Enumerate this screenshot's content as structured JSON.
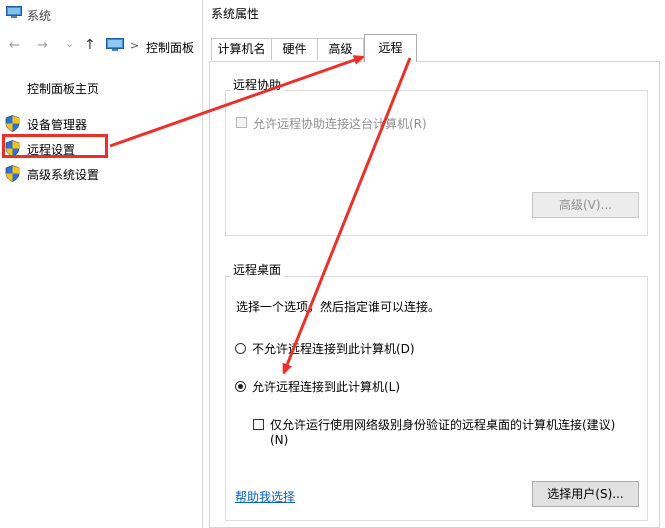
{
  "control_panel": {
    "window_title": "系统",
    "nav": {
      "back": "←",
      "forward": "→",
      "dropdown": "⌄",
      "up": "↑"
    },
    "breadcrumb_sep": ">",
    "address": "控制面板",
    "home_link": "控制面板主页",
    "links": [
      {
        "label": "设备管理器",
        "icon": "uac-shield-icon"
      },
      {
        "label": "远程设置",
        "icon": "uac-shield-icon"
      },
      {
        "label": "高级系统设置",
        "icon": "uac-shield-icon"
      }
    ]
  },
  "dialog": {
    "title": "系统属性",
    "tabs": [
      "计算机名",
      "硬件",
      "高级",
      "远程"
    ],
    "active_tab": "远程",
    "remote_assistance": {
      "group_title": "远程协助",
      "allow_checkbox": "允许远程协助连接这台计算机(R)",
      "advanced_button": "高级(V)..."
    },
    "remote_desktop": {
      "group_title": "远程桌面",
      "instruction": "选择一个选项，然后指定谁可以连接。",
      "option_deny": "不允许远程连接到此计算机(D)",
      "option_allow": "允许远程连接到此计算机(L)",
      "nla_checkbox_line1": "仅允许运行使用网络级别身份验证的远程桌面的计算机连接(建议)",
      "nla_checkbox_line2": "(N)",
      "help_link": "帮助我选择",
      "select_users_button": "选择用户(S)..."
    }
  },
  "annotation": {
    "color": "#e8312a"
  }
}
